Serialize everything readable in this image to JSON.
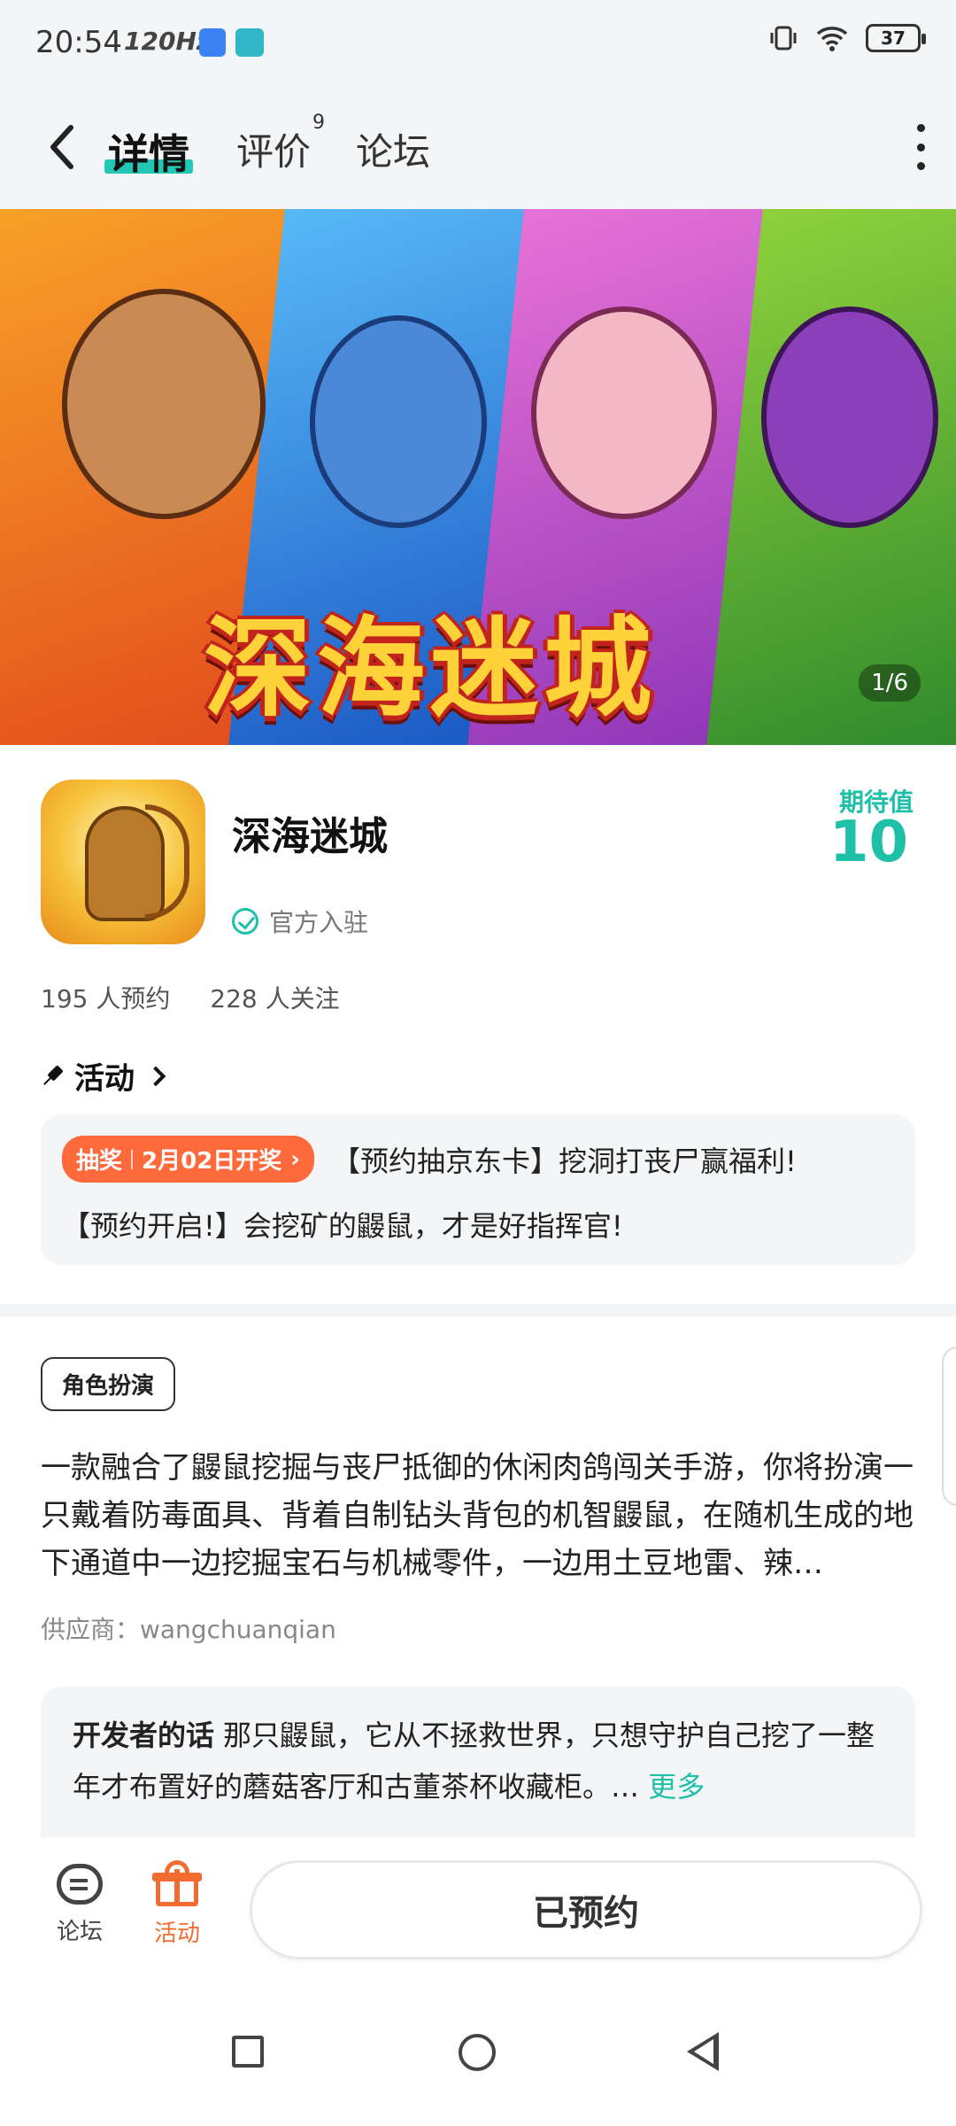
{
  "status_bar": {
    "time": "20:54",
    "refresh_rate": "120Hz",
    "battery": "37"
  },
  "header": {
    "tabs": [
      {
        "label": "详情",
        "active": true
      },
      {
        "label": "评价",
        "badge": "9"
      },
      {
        "label": "论坛"
      }
    ],
    "accent_color": "#24c7b5"
  },
  "banner": {
    "title": "深海迷城",
    "counter": "1/6"
  },
  "app": {
    "name": "深海迷城",
    "verified_label": "官方入驻",
    "expect_label": "期待值",
    "expect_value": "10",
    "reservations": "195 人预约",
    "followers": "228 人关注"
  },
  "activity": {
    "heading": "活动",
    "badge_type": "抽奖",
    "badge_date": "2月02日开奖",
    "line1": "【预约抽京东卡】挖洞打丧尸赢福利!",
    "line2": "【预约开启!】会挖矿的鼹鼠，才是好指挥官!"
  },
  "description": {
    "tag": "角色扮演",
    "text": "一款融合了鼹鼠挖掘与丧尸抵御的休闲肉鸽闯关手游，你将扮演一只戴着防毒面具、背着自制钻头背包的机智鼹鼠，在随机生成的地下通道中一边挖掘宝石与机械零件，一边用土豆地雷、辣…",
    "supplier": "供应商：wangchuanqian"
  },
  "developer": {
    "label": "开发者的话",
    "text": "那只鼹鼠，它从不拯救世界，只想守护自己挖了一整年才布置好的蘑菇客厅和古董茶杯收藏柜。…",
    "more": "更多"
  },
  "bottom_bar": {
    "forum_label": "论坛",
    "activity_label": "活动",
    "reserve_button": "已预约"
  },
  "icons": [
    "back-arrow-icon",
    "more-vert-icon",
    "check-circle-icon",
    "pin-icon",
    "chevron-right-icon",
    "forum-icon",
    "gift-icon",
    "nav-square-icon",
    "nav-circle-icon",
    "nav-back-icon"
  ]
}
